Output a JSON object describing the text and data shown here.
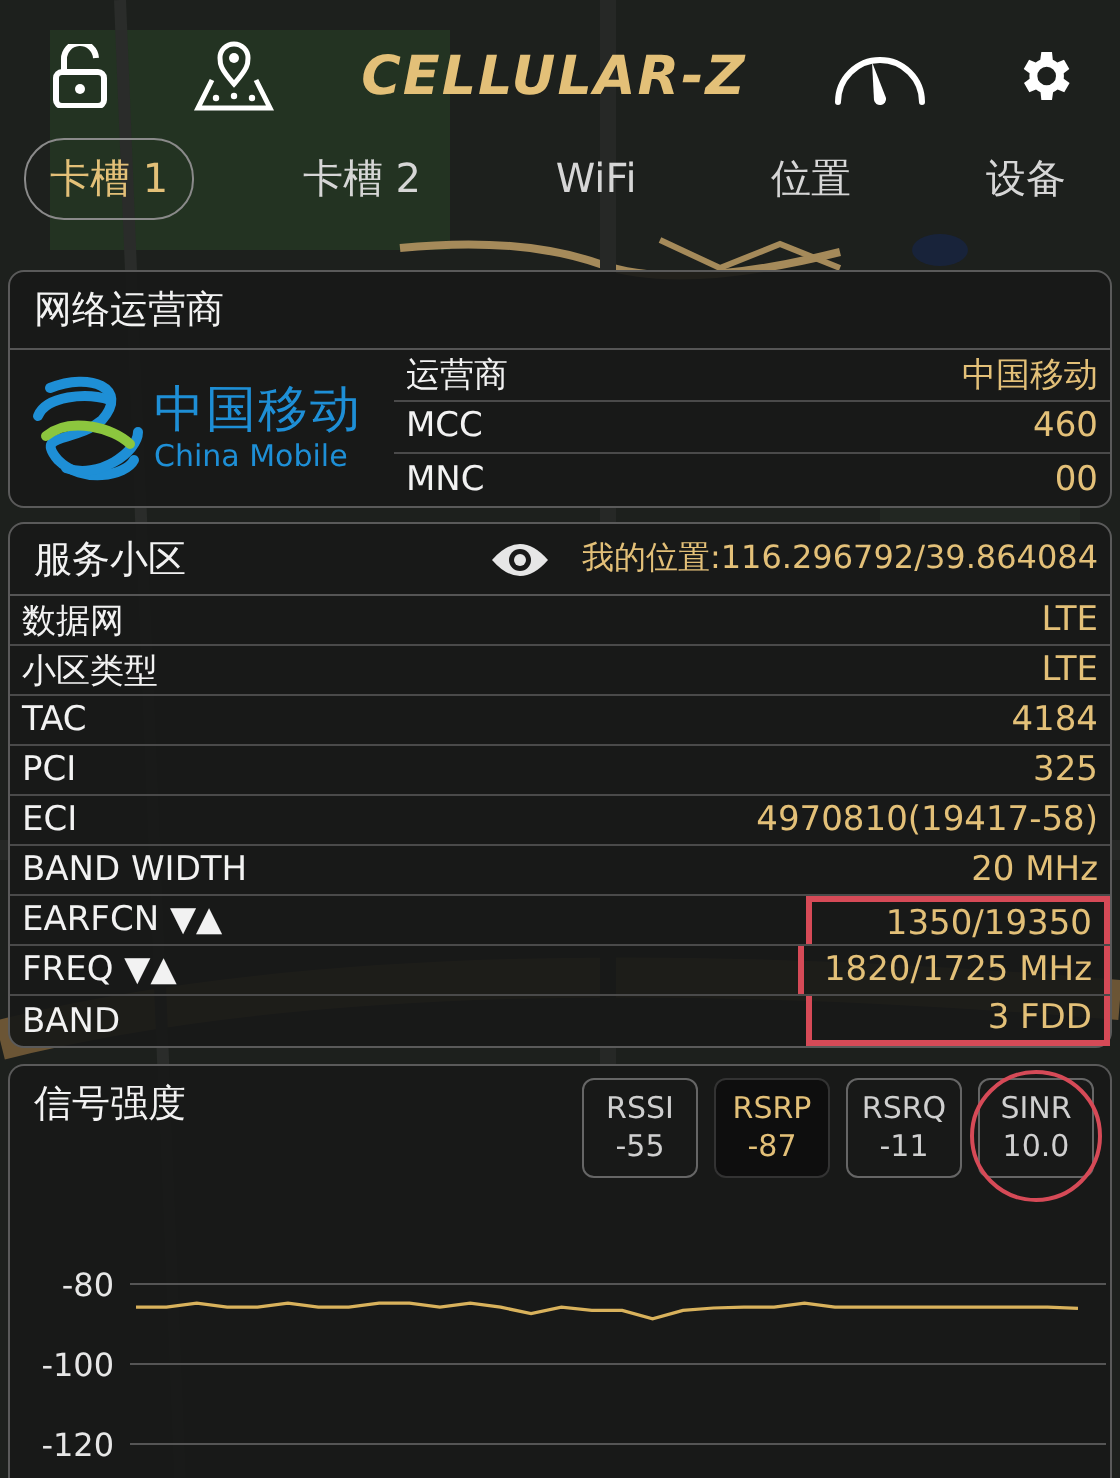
{
  "header": {
    "logo": "CELLULAR-Z"
  },
  "tabs": [
    {
      "label": "卡槽 1",
      "selected": true
    },
    {
      "label": "卡槽 2",
      "selected": false
    },
    {
      "label": "WiFi",
      "selected": false
    },
    {
      "label": "位置",
      "selected": false
    },
    {
      "label": "设备",
      "selected": false
    }
  ],
  "operator": {
    "title": "网络运营商",
    "logo_cn": "中国移动",
    "logo_en": "China Mobile",
    "rows": [
      {
        "label": "运营商",
        "value": "中国移动"
      },
      {
        "label": "MCC",
        "value": "460"
      },
      {
        "label": "MNC",
        "value": "00"
      }
    ]
  },
  "serving_cell": {
    "title": "服务小区",
    "location": "我的位置:116.296792/39.864084",
    "rows": [
      {
        "label": "数据网",
        "value": "LTE",
        "boxed": false
      },
      {
        "label": "小区类型",
        "value": "LTE",
        "boxed": false
      },
      {
        "label": "TAC",
        "value": "4184",
        "boxed": false
      },
      {
        "label": "PCI",
        "value": "325",
        "boxed": false
      },
      {
        "label": "ECI",
        "value": "4970810(19417-58)",
        "boxed": false
      },
      {
        "label": "BAND WIDTH",
        "value": "20 MHz",
        "boxed": false
      },
      {
        "label": "EARFCN ▼▲",
        "value": "1350/19350",
        "boxed": true
      },
      {
        "label": "FREQ ▼▲",
        "value": "1820/1725 MHz",
        "boxed": true
      },
      {
        "label": "BAND",
        "value": "3 FDD",
        "boxed": true
      }
    ]
  },
  "signal": {
    "title": "信号强度",
    "metrics": [
      {
        "label": "RSSI",
        "value": "-55",
        "selected": false,
        "circled": false
      },
      {
        "label": "RSRP",
        "value": "-87",
        "selected": true,
        "circled": false
      },
      {
        "label": "RSRQ",
        "value": "-11",
        "selected": false,
        "circled": false
      },
      {
        "label": "SINR",
        "value": "10.0",
        "selected": false,
        "circled": true
      }
    ],
    "chart_data": {
      "type": "line",
      "ylim": [
        -120,
        -80
      ],
      "yticks": [
        -80,
        -100,
        -120
      ],
      "grid": true,
      "series": [
        {
          "color": "#d9b25c",
          "values": [
            -85.8,
            -85.8,
            -84.8,
            -85.8,
            -85.8,
            -84.8,
            -85.8,
            -85.8,
            -84.8,
            -84.8,
            -85.8,
            -84.8,
            -85.8,
            -87.4,
            -85.8,
            -86.6,
            -86.6,
            -88.7,
            -86.6,
            -86,
            -85.8,
            -85.8,
            -84.8,
            -85.8,
            -85.8,
            -85.8,
            -85.8,
            -85.8,
            -85.8,
            -85.8,
            -85.8,
            -86.1
          ]
        }
      ]
    }
  }
}
